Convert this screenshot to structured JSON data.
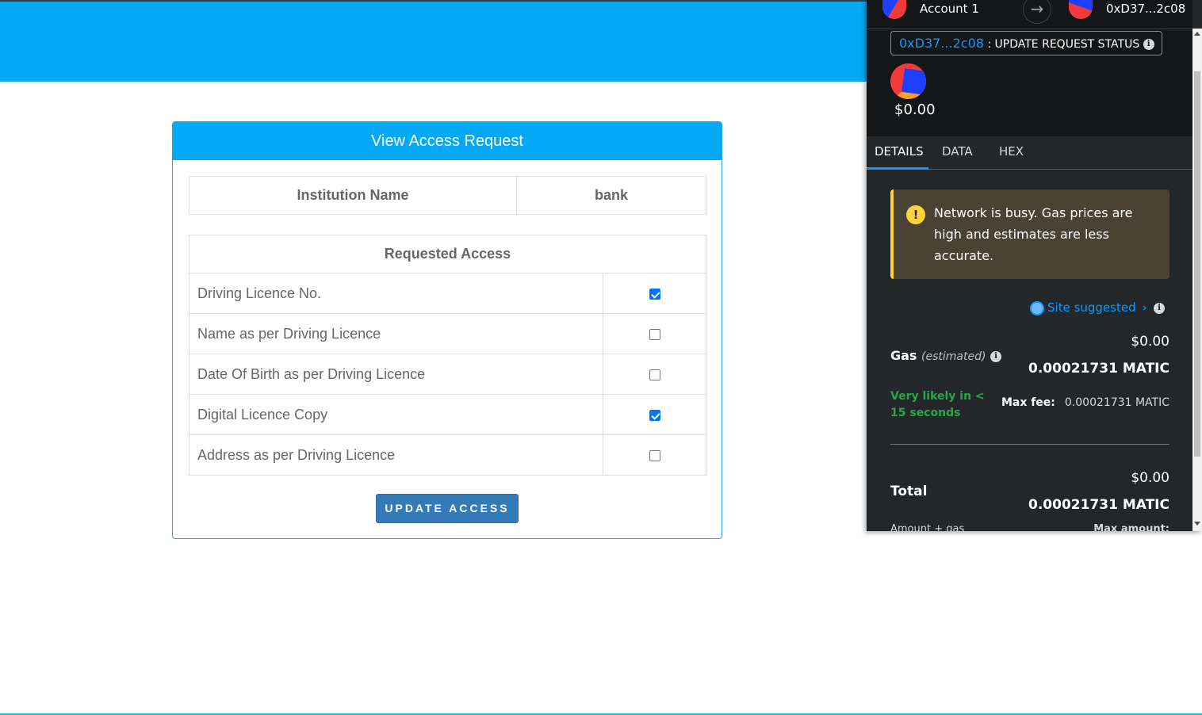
{
  "card": {
    "title": "View Access Request",
    "institution_label": "Institution Name",
    "institution_value": "bank",
    "requested_header": "Requested Access",
    "items": [
      {
        "label": "Driving Licence No.",
        "checked": true
      },
      {
        "label": "Name as per Driving Licence",
        "checked": false
      },
      {
        "label": "Date Of Birth as per Driving Licence",
        "checked": false
      },
      {
        "label": "Digital Licence Copy",
        "checked": true
      },
      {
        "label": "Address as per Driving Licence",
        "checked": false
      }
    ],
    "button_label": "UPDATE ACCESS"
  },
  "wallet": {
    "account_name": "Account 1",
    "to_address": "0xD37...2c08",
    "method_address": "0xD37...2c08",
    "method_name": ": UPDATE REQUEST STATUS",
    "fiat_balance": "$0.00",
    "tabs": [
      "DETAILS",
      "DATA",
      "HEX"
    ],
    "active_tab": "DETAILS",
    "warning": "Network is busy. Gas prices are high and estimates are less accurate.",
    "site_suggested": "Site suggested",
    "gas_label": "Gas",
    "gas_estimated": "(estimated)",
    "gas_fiat": "$0.00",
    "gas_value": "0.00021731 MATIC",
    "likely": "Very likely in < 15 seconds",
    "max_fee_label": "Max fee:",
    "max_fee_value": "0.00021731 MATIC",
    "total_label": "Total",
    "total_fiat": "$0.00",
    "total_value": "0.00021731 MATIC",
    "amount_gas_label": "Amount + gas",
    "max_amount_label": "Max amount:"
  },
  "colors": {
    "header": "#03a9f4",
    "button": "#337ab7",
    "wallet_bg": "#24272a",
    "link": "#1098fc",
    "warning_accent": "#ffd33d",
    "success": "#28a745"
  },
  "icons": {
    "info": "info-icon",
    "warning": "warning-icon",
    "arrow": "arrow-right-icon",
    "globe": "globe-icon",
    "chevron": "chevron-right-icon"
  }
}
